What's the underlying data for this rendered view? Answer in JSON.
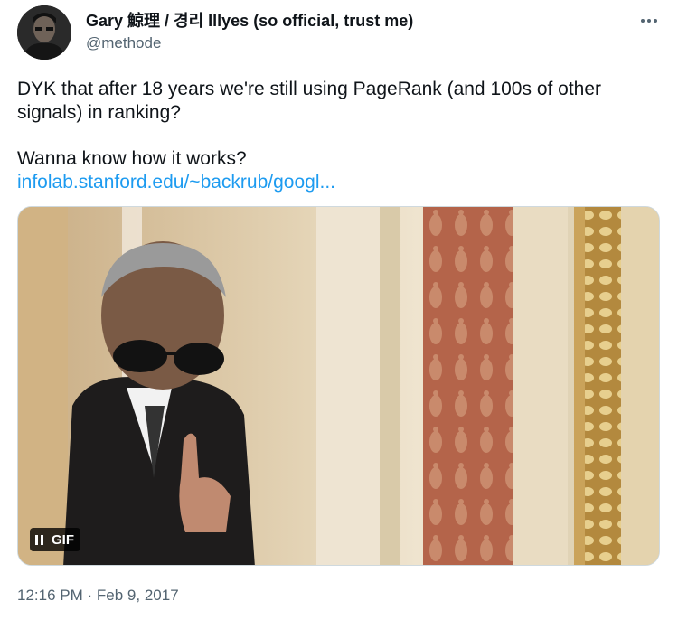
{
  "author": {
    "display_name": "Gary 鯨理 / 경리 Illyes (so official, trust me)",
    "handle": "@methode"
  },
  "tweet": {
    "line1": "DYK that after 18 years we're still using PageRank (and 100s of other signals) in ranking?",
    "line2": "Wanna know how it works?",
    "link_text": "infolab.stanford.edu/~backrub/googl..."
  },
  "media": {
    "badge_label": "GIF",
    "icons": [
      "pause-icon"
    ]
  },
  "meta": {
    "time": "12:16 PM",
    "separator": "·",
    "date": "Feb 9, 2017"
  },
  "colors": {
    "text": "#0f1419",
    "secondary": "#536471",
    "link": "#1d9bf0"
  }
}
